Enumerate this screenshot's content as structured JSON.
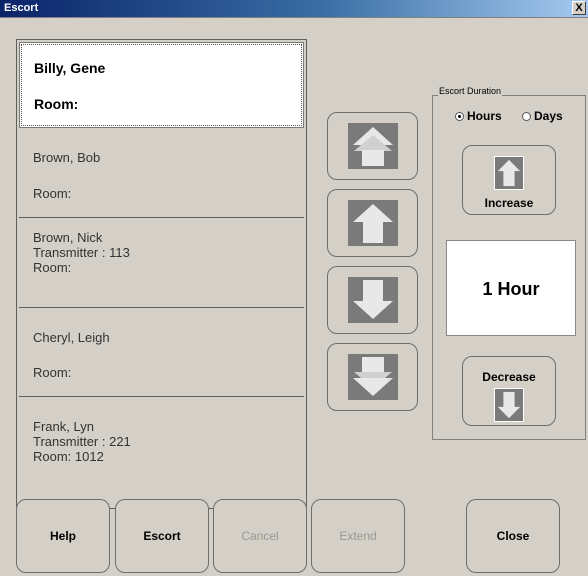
{
  "window": {
    "title": "Escort",
    "close_glyph": "X"
  },
  "residents": [
    {
      "lines": [
        "Billy, Gene",
        "",
        "Room:"
      ],
      "selected": true
    },
    {
      "lines": [
        "Brown, Bob",
        "",
        "Room:"
      ],
      "selected": false
    },
    {
      "lines": [
        "Brown, Nick",
        "Transmitter : 113",
        "Room:"
      ],
      "selected": false
    },
    {
      "lines": [
        "Cheryl, Leigh",
        "",
        "Room:"
      ],
      "selected": false
    },
    {
      "lines": [
        "Frank, Lyn",
        "Transmitter : 221",
        "Room: 1012"
      ],
      "selected": false
    }
  ],
  "scroll_buttons": [
    {
      "icon": "double-arrow-up-icon"
    },
    {
      "icon": "arrow-up-icon"
    },
    {
      "icon": "arrow-down-icon"
    },
    {
      "icon": "double-arrow-down-icon"
    }
  ],
  "duration_panel": {
    "group_label": "Escort Duration",
    "unit_hours": "Hours",
    "unit_days": "Days",
    "selected_unit": "Hours",
    "increase_label": "Increase",
    "decrease_label": "Decrease",
    "value": "1 Hour"
  },
  "footer": {
    "help": "Help",
    "escort": "Escort",
    "cancel": "Cancel",
    "extend": "Extend",
    "close": "Close"
  },
  "colors": {
    "background": "#d4d0c8",
    "selected_row": "#ffffff",
    "arrow_fill": "#7a7a7a",
    "disabled_text": "#9a9890"
  }
}
